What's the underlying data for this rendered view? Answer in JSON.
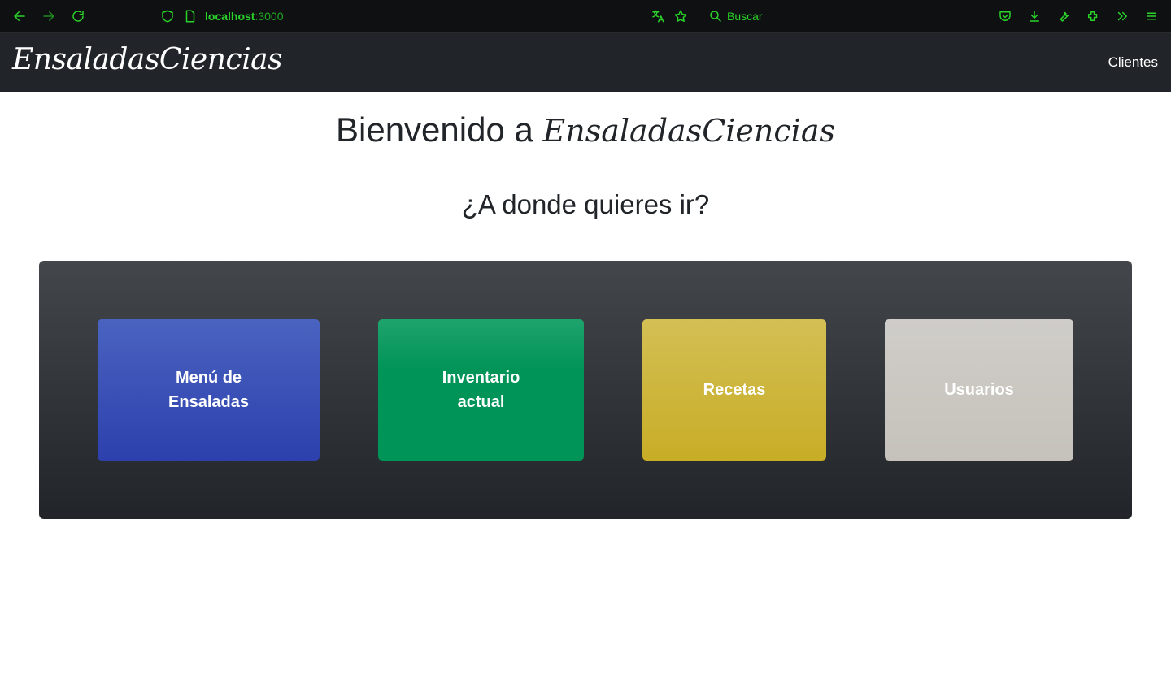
{
  "browser": {
    "url_host": "localhost",
    "url_port": ":3000",
    "search_label": "Buscar"
  },
  "navbar": {
    "brand": "EnsaladasCiencias",
    "link_clientes": "Clientes"
  },
  "main": {
    "welcome_prefix": "Bienvenido a",
    "welcome_brand": "EnsaladasCiencias",
    "question": "¿A donde quieres ir?",
    "tiles": [
      {
        "label": "Menú de Ensaladas",
        "color": "#3b50b6"
      },
      {
        "label": "Inventario actual",
        "color": "#019458"
      },
      {
        "label": "Recetas",
        "color": "#cdb53a"
      },
      {
        "label": "Usuarios",
        "color": "#cac7c1"
      }
    ]
  }
}
